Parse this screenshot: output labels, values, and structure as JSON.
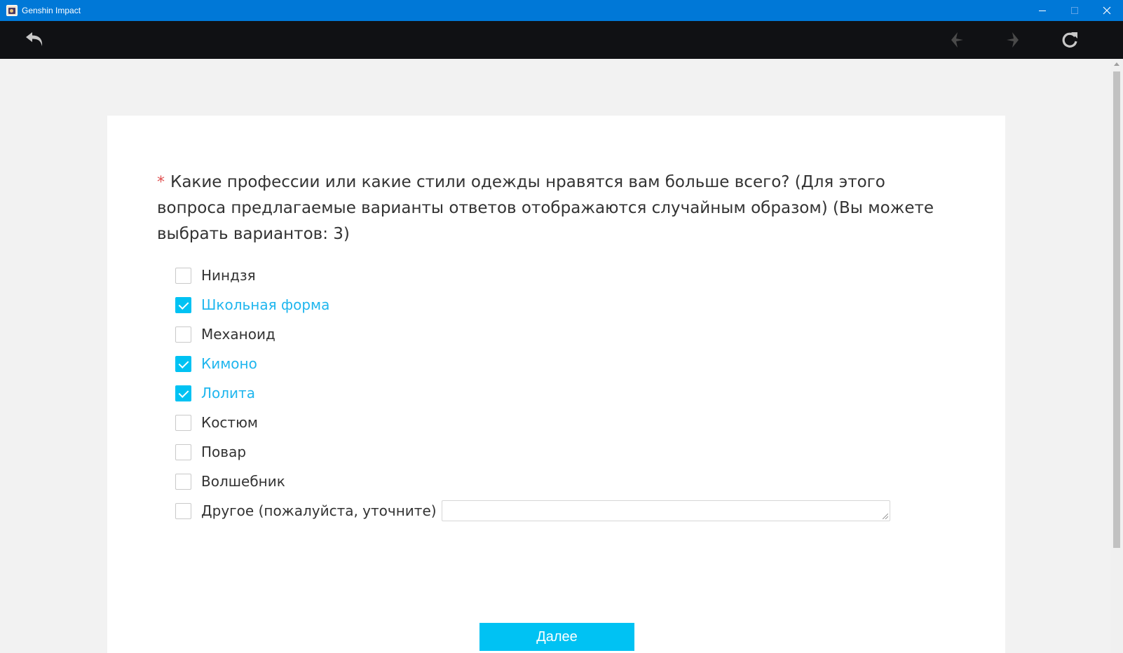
{
  "window": {
    "title": "Genshin Impact"
  },
  "icons": {
    "back": "undo-arrow-icon",
    "prev": "previous-arrow-icon",
    "next": "next-arrow-icon",
    "reload": "reload-icon"
  },
  "colors": {
    "titlebar": "#0078d7",
    "toolbar": "#101114",
    "accent": "#00c2f3",
    "required": "#e05050",
    "selected_text": "#1fb6ee"
  },
  "question": {
    "required_mark": "*",
    "text": "Какие профессии или какие стили одежды нравятся вам больше всего? (Для этого вопроса предлагаемые варианты ответов отображаются случайным образом) (Вы можете выбрать вариантов: 3)"
  },
  "options": [
    {
      "label": "Ниндзя",
      "checked": false
    },
    {
      "label": "Школьная форма",
      "checked": true
    },
    {
      "label": "Механоид",
      "checked": false
    },
    {
      "label": "Кимоно",
      "checked": true
    },
    {
      "label": "Лолита",
      "checked": true
    },
    {
      "label": "Костюм",
      "checked": false
    },
    {
      "label": "Повар",
      "checked": false
    },
    {
      "label": "Волшебник",
      "checked": false
    },
    {
      "label": "Другое (пожалуйста, уточните)",
      "checked": false,
      "has_input": true,
      "input_value": ""
    }
  ],
  "next_button": {
    "label": "Далее"
  }
}
